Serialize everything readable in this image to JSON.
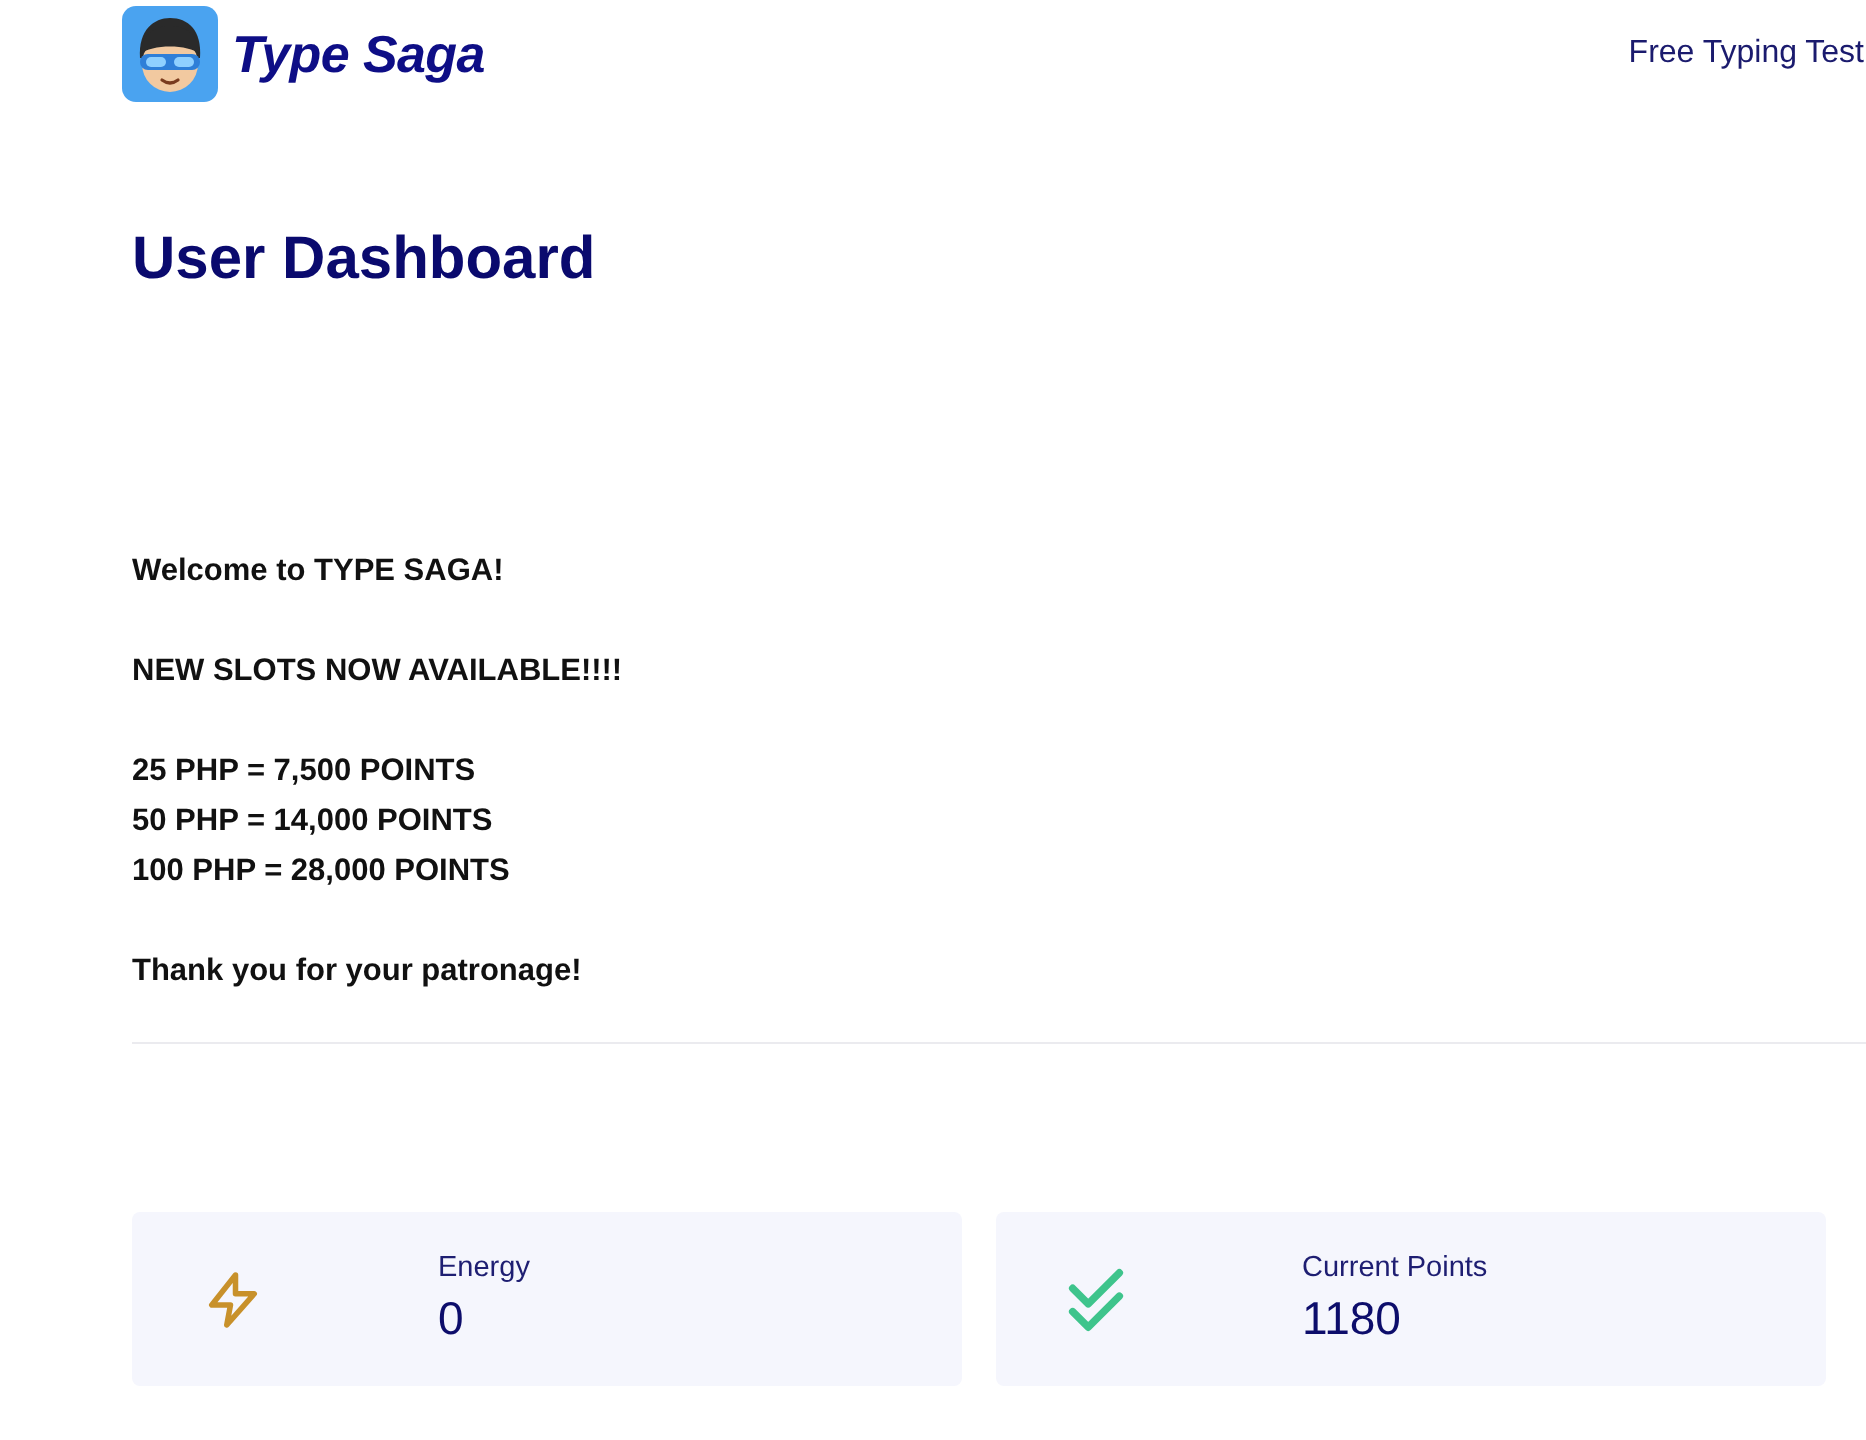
{
  "header": {
    "logo_text": "Type Saga",
    "nav_links": [
      {
        "label": "Free Typing Test"
      }
    ]
  },
  "page_title": "User Dashboard",
  "announcement": {
    "paragraphs": [
      [
        "Welcome to TYPE SAGA!"
      ],
      [
        "NEW SLOTS NOW AVAILABLE!!!!"
      ],
      [
        "25 PHP = 7,500 POINTS",
        "50 PHP = 14,000 POINTS",
        "100 PHP = 28,000 POINTS"
      ],
      [
        "Thank you for your patronage!"
      ]
    ]
  },
  "stats": [
    {
      "kind": "energy",
      "label": "Energy",
      "value": "0"
    },
    {
      "kind": "points",
      "label": "Current Points",
      "value": "1180"
    }
  ]
}
